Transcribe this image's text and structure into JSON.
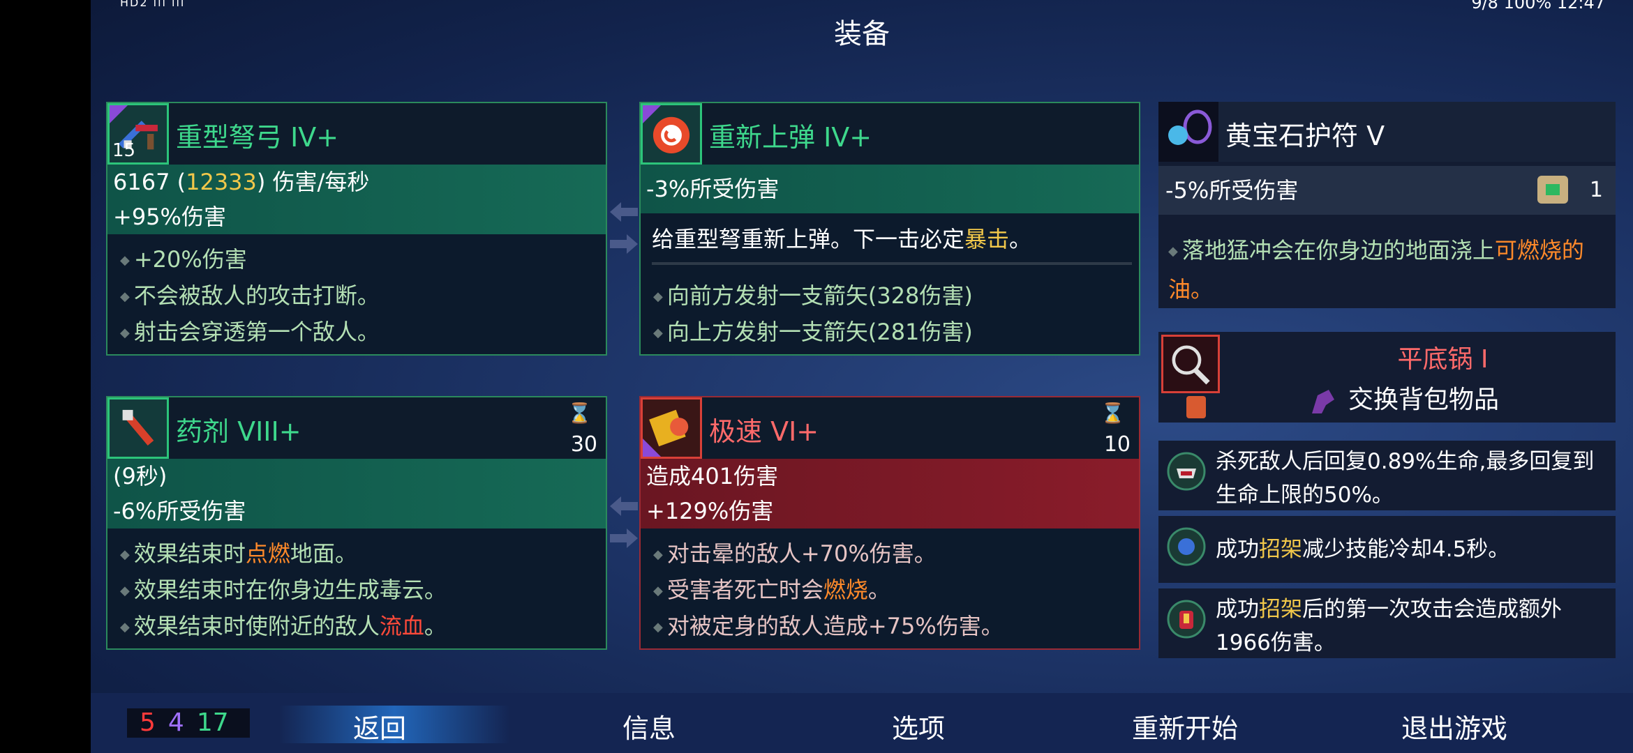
{
  "status": {
    "left": "HD2 ıll ıll",
    "right": "9/8 100% 12:47"
  },
  "title": "装备",
  "weapons": [
    {
      "name": "重型弩弓 IV+",
      "level": "15",
      "stat1_base": "6167 (",
      "stat1_gold": "12333",
      "stat1_tail": ") 伤害/每秒",
      "stat2": "+95%伤害",
      "bullets": [
        "+20%伤害",
        "不会被敌人的攻击打断。",
        "射击会穿透第一个敌人。"
      ]
    },
    {
      "name": "重新上弹 IV+",
      "stat1": "-3%所受伤害",
      "desc_a": "给重型弩重新上弹。下一击必定",
      "desc_gold": "暴击",
      "desc_b": "。",
      "bullets": [
        "向前方发射一支箭矢(328伤害)",
        "向上方发射一支箭矢(281伤害)"
      ]
    }
  ],
  "skills": [
    {
      "name": "药剂 VIII+",
      "cooldown": "30",
      "stat1": "(9秒)",
      "stat2": "-6%所受伤害",
      "b1_a": "效果结束时",
      "b1_c": "点燃",
      "b1_b": "地面。",
      "b2": "效果结束时在你身边生成毒云。",
      "b3_a": "效果结束时使附近的敌人",
      "b3_c": "流血",
      "b3_b": "。"
    },
    {
      "name": "极速 VI+",
      "cooldown": "10",
      "stat1": "造成401伤害",
      "stat2": "+129%伤害",
      "b1": "对击晕的敌人+70%伤害。",
      "b2_a": "受害者死亡时会",
      "b2_c": "燃烧",
      "b2_b": "。",
      "b3": "对被定身的敌人造成+75%伤害。"
    }
  ],
  "amulet": {
    "name": "黄宝石护符 V",
    "stat": "-5%所受伤害",
    "scroll_count": "1",
    "bullet_a": "落地猛冲会在你身边的地面浇上",
    "bullet_c": "可燃烧",
    "bullet_b": "的油。"
  },
  "backpack": {
    "name": "平底锅 I",
    "swap_label": "交换背包物品"
  },
  "mutations": [
    {
      "text": "杀死敌人后回复0.89%生命,最多回复到生命上限的50%。"
    },
    {
      "a": "成功",
      "c": "招架",
      "b": "减少技能冷却4.5秒。"
    },
    {
      "a": "成功",
      "c": "招架",
      "b": "后的第一次攻击会造成额外1966伤害。"
    }
  ],
  "cells": {
    "red": "5",
    "purple": "4",
    "green": "17"
  },
  "menu": {
    "back": "返回",
    "info": "信息",
    "options": "选项",
    "restart": "重新开始",
    "quit": "退出游戏"
  },
  "colors": {
    "green_border": "#2b8a5c",
    "red_border": "#9a2a34",
    "gold": "#f2c84a",
    "orange": "#ff8a2a"
  }
}
